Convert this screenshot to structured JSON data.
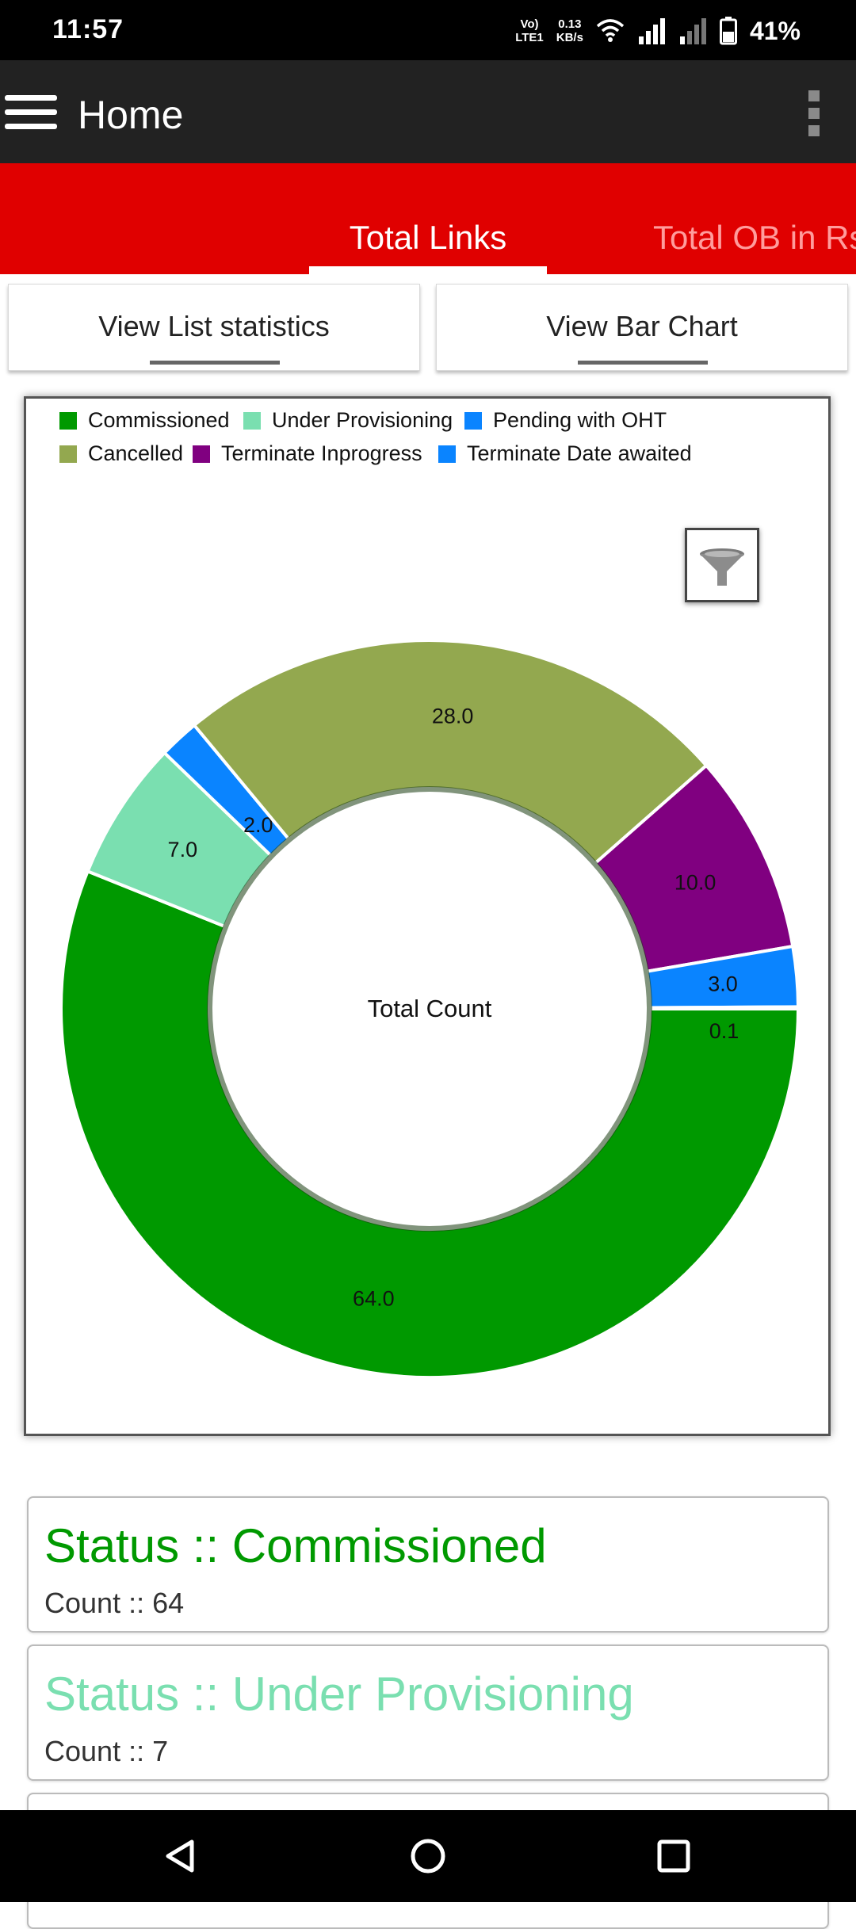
{
  "status_bar": {
    "time": "11:57",
    "network_type": "Vo)\nLTE1",
    "speed": "0.13\nKB/s",
    "battery": "41%",
    "icons": [
      "wifi-icon",
      "signal-icon",
      "signal-weak-icon",
      "battery-icon"
    ]
  },
  "app_bar": {
    "title": "Home",
    "menu_icon": "hamburger-menu-icon",
    "overflow_icon": "more-vertical-icon"
  },
  "tabs": [
    {
      "label": "Total Links",
      "active": true
    },
    {
      "label": "Total OB in Rs",
      "active": false
    }
  ],
  "buttons": {
    "list_stats": "View List statistics",
    "bar_chart": "View Bar Chart"
  },
  "chart_data": {
    "type": "pie",
    "center_label": "Total Count",
    "legend": [
      {
        "label": "Commissioned",
        "color": "#009900"
      },
      {
        "label": "Under Provisioning",
        "color": "#7adfb0"
      },
      {
        "label": "Pending with OHT",
        "color": "#0a84ff"
      },
      {
        "label": "Cancelled",
        "color": "#93a84f"
      },
      {
        "label": "Terminate Inprogress",
        "color": "#800080"
      },
      {
        "label": "Terminate Date awaited",
        "color": "#0a84ff"
      }
    ],
    "slices": [
      {
        "label": "Commissioned",
        "value": 64.0,
        "display": "64.0",
        "color": "#009900"
      },
      {
        "label": "Under Provisioning",
        "value": 7.0,
        "display": "7.0",
        "color": "#7adfb0"
      },
      {
        "label": "Pending with OHT",
        "value": 2.0,
        "display": "2.0",
        "color": "#0a84ff"
      },
      {
        "label": "Cancelled",
        "value": 28.0,
        "display": "28.0",
        "color": "#93a84f"
      },
      {
        "label": "Terminate Inprogress",
        "value": 10.0,
        "display": "10.0",
        "color": "#800080"
      },
      {
        "label": "Terminate Date awaited",
        "value": 3.0,
        "display": "3.0",
        "color": "#0a84ff"
      },
      {
        "label": "",
        "value": 0.1,
        "display": "0.1",
        "color": "#0a84ff"
      }
    ],
    "filter_icon": "filter-funnel-icon"
  },
  "status_cards": [
    {
      "title": "Status :: Commissioned",
      "count": "Count :: 64",
      "color": "#009900"
    },
    {
      "title": "Status :: Under Provisioning",
      "count": "Count :: 7",
      "color": "#7adfb0"
    }
  ],
  "nav_bar": {
    "icons": [
      "back-icon",
      "home-icon",
      "recents-icon"
    ]
  }
}
